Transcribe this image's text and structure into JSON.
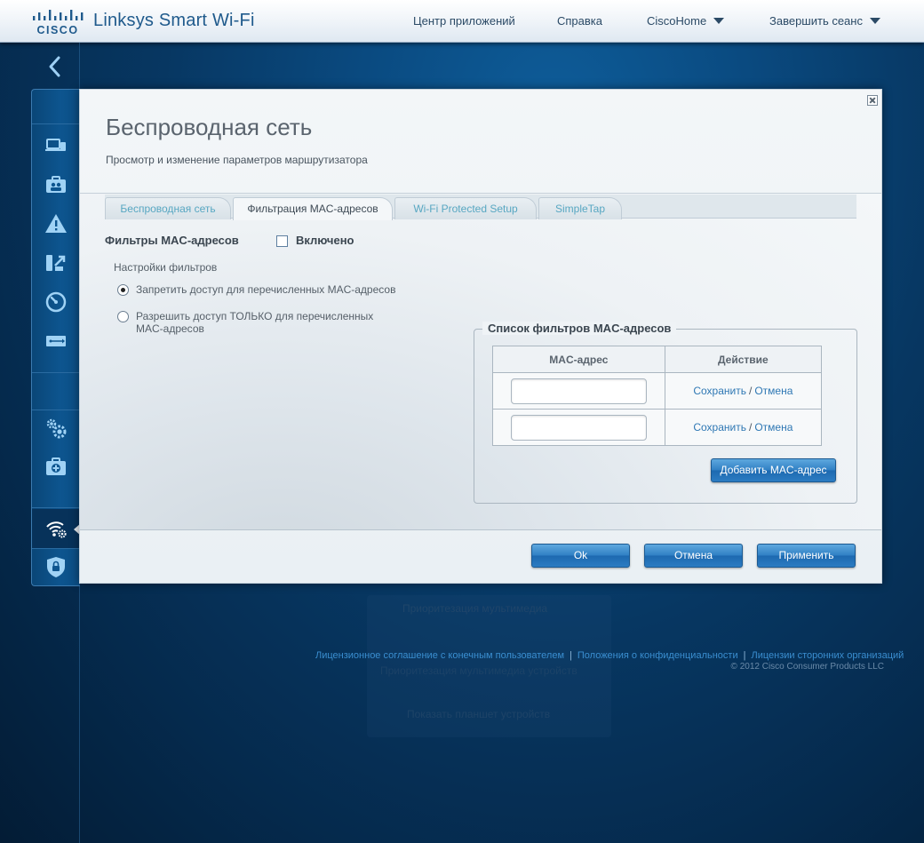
{
  "header": {
    "product_name": "Linksys Smart Wi-Fi",
    "nav": {
      "app_center": "Центр приложений",
      "help": "Справка",
      "user": "CiscoHome",
      "logout": "Завершить сеанс"
    }
  },
  "sidebar": {
    "items": [
      {
        "icon": "devices-icon"
      },
      {
        "icon": "parental-controls-icon"
      },
      {
        "icon": "troubleshooting-icon"
      },
      {
        "icon": "media-prioritization-icon"
      },
      {
        "icon": "speed-test-icon"
      },
      {
        "icon": "usb-storage-icon"
      },
      {
        "icon": "connectivity-icon"
      },
      {
        "icon": "troubleshoot-kit-icon"
      },
      {
        "icon": "wireless-settings-icon",
        "active": true
      },
      {
        "icon": "security-icon"
      }
    ]
  },
  "dialog": {
    "title": "Беспроводная сеть",
    "subtitle": "Просмотр и изменение параметров маршрутизатора",
    "tabs": [
      {
        "label": "Беспроводная сеть"
      },
      {
        "label": "Фильтрация MAC-адресов",
        "active": true
      },
      {
        "label": "Wi-Fi Protected Setup"
      },
      {
        "label": "SimpleTap"
      }
    ],
    "mac_filters": {
      "title": "Фильтры MAC-адресов",
      "enabled_label": "Включено",
      "enabled": false,
      "settings_label": "Настройки фильтров",
      "options": [
        {
          "label": "Запретить доступ для перечисленных MAC-адресов",
          "selected": true
        },
        {
          "label_line1": "Разрешить доступ ТОЛЬКО для перечисленных",
          "label_line2": "MAC-адресов",
          "selected": false
        }
      ]
    },
    "mac_list": {
      "legend": "Список фильтров MAC-адресов",
      "columns": [
        "MAC-адрес",
        "Действие"
      ],
      "rows": [
        {
          "mac": "",
          "save": "Сохранить",
          "cancel": "Отмена"
        },
        {
          "mac": "",
          "save": "Сохранить",
          "cancel": "Отмена"
        }
      ],
      "add_button": "Добавить MAC-адрес"
    },
    "buttons": {
      "ok": "Ok",
      "cancel": "Отмена",
      "apply": "Применить"
    }
  },
  "background": {
    "ghost_title": "Приоритезация мультимедиа",
    "ghost_text": "Приоритезация мультимедиа устройств",
    "ghost_link": "Показать планшет устройств"
  },
  "footer": {
    "links": [
      "Лицензионное соглашение с конечным пользователем",
      "Положения о конфиденциальности",
      "Лицензии сторонних организаций"
    ],
    "copyright": "© 2012 Cisco Consumer Products LLC"
  },
  "colors": {
    "accent_blue": "#2f7fc4",
    "link_blue": "#2f78b4",
    "tab_text": "#58a7c2",
    "background_dark": "#052a4d"
  }
}
